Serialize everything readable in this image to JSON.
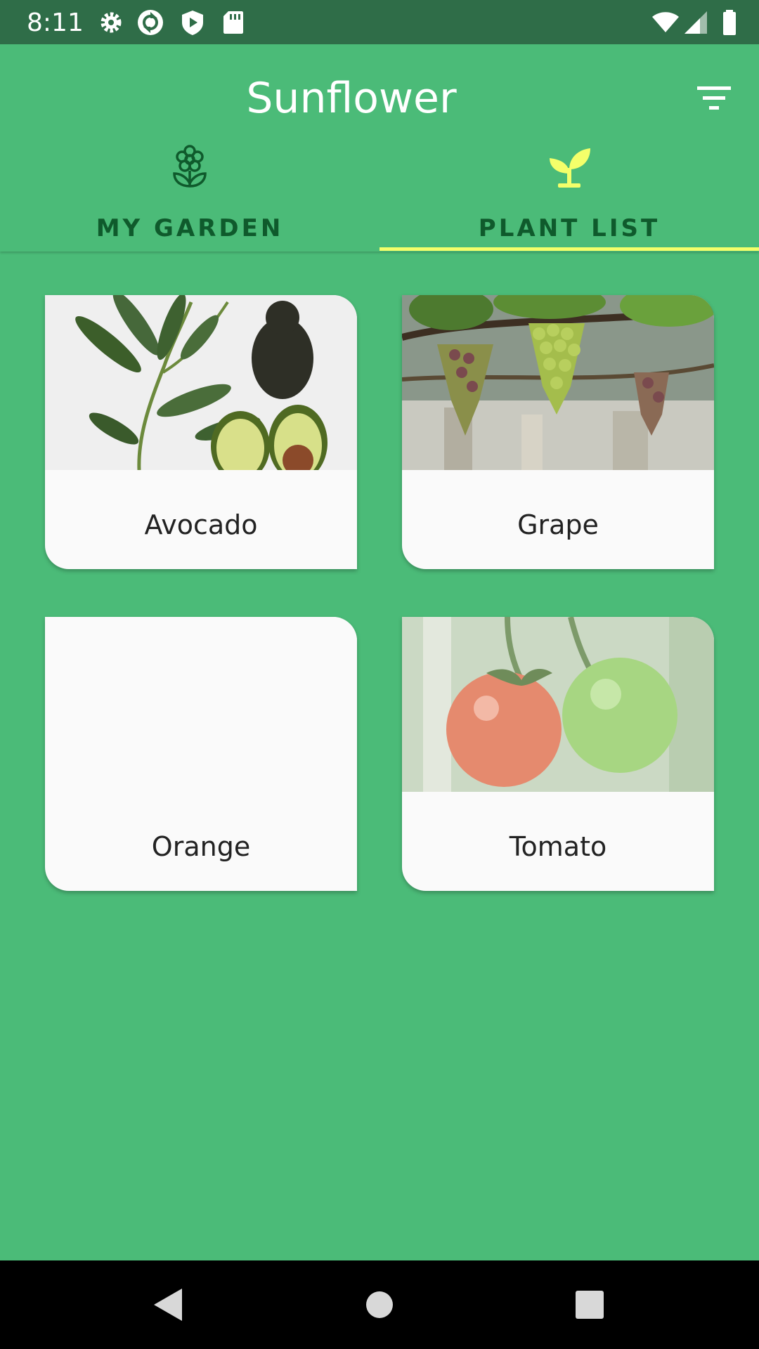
{
  "status_bar": {
    "time": "8:11",
    "left_icons": [
      "gear-icon",
      "sync-icon",
      "play-protect-icon",
      "sd-card-icon"
    ],
    "right_icons": [
      "wifi-icon",
      "signal-icon",
      "battery-icon"
    ]
  },
  "app_bar": {
    "title": "Sunflower",
    "filter_icon": "filter-list-icon"
  },
  "tabs": [
    {
      "label": "MY GARDEN",
      "icon": "flower-icon",
      "selected": false
    },
    {
      "label": "PLANT LIST",
      "icon": "sprout-icon",
      "selected": true
    }
  ],
  "plants": [
    {
      "name": "Avocado",
      "image": "avocado-photo"
    },
    {
      "name": "Grape",
      "image": "grape-photo"
    },
    {
      "name": "Orange",
      "image": ""
    },
    {
      "name": "Tomato",
      "image": "tomato-photo"
    }
  ],
  "colors": {
    "primary": "#4bbb78",
    "status_bar": "#2f6d48",
    "tab_text": "#0f5a2c",
    "tab_indicator": "#f4ff6a",
    "card": "#fafafa"
  },
  "nav_bar": {
    "buttons": [
      "back-icon",
      "home-icon",
      "recents-icon"
    ]
  }
}
